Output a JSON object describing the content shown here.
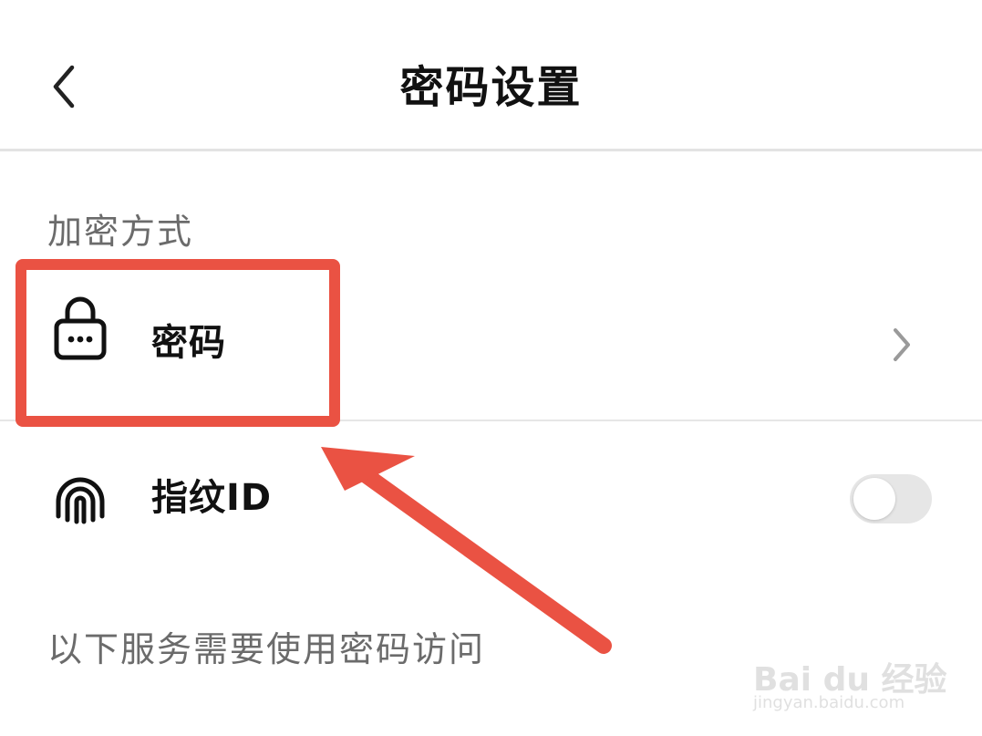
{
  "header": {
    "title": "密码设置",
    "back_icon": "chevron-left-icon"
  },
  "section": {
    "label": "加密方式"
  },
  "rows": [
    {
      "label": "密码",
      "icon": "lock-icon",
      "trailing": "chevron-right-icon"
    },
    {
      "label": "指纹ID",
      "icon": "fingerprint-icon",
      "toggle_on": false
    }
  ],
  "footer": {
    "label": "以下服务需要使用密码访问"
  },
  "annotation": {
    "highlight_color": "#ea5243",
    "arrow_color": "#ea5243"
  },
  "watermark": {
    "main": "Bai du 经验",
    "sub": "jingyan.baidu.com"
  },
  "colors": {
    "title_text": "#111111",
    "secondary_text": "#6b6b6b",
    "divider": "#e3e3e3",
    "toggle_off_track": "#e6e6e6"
  }
}
